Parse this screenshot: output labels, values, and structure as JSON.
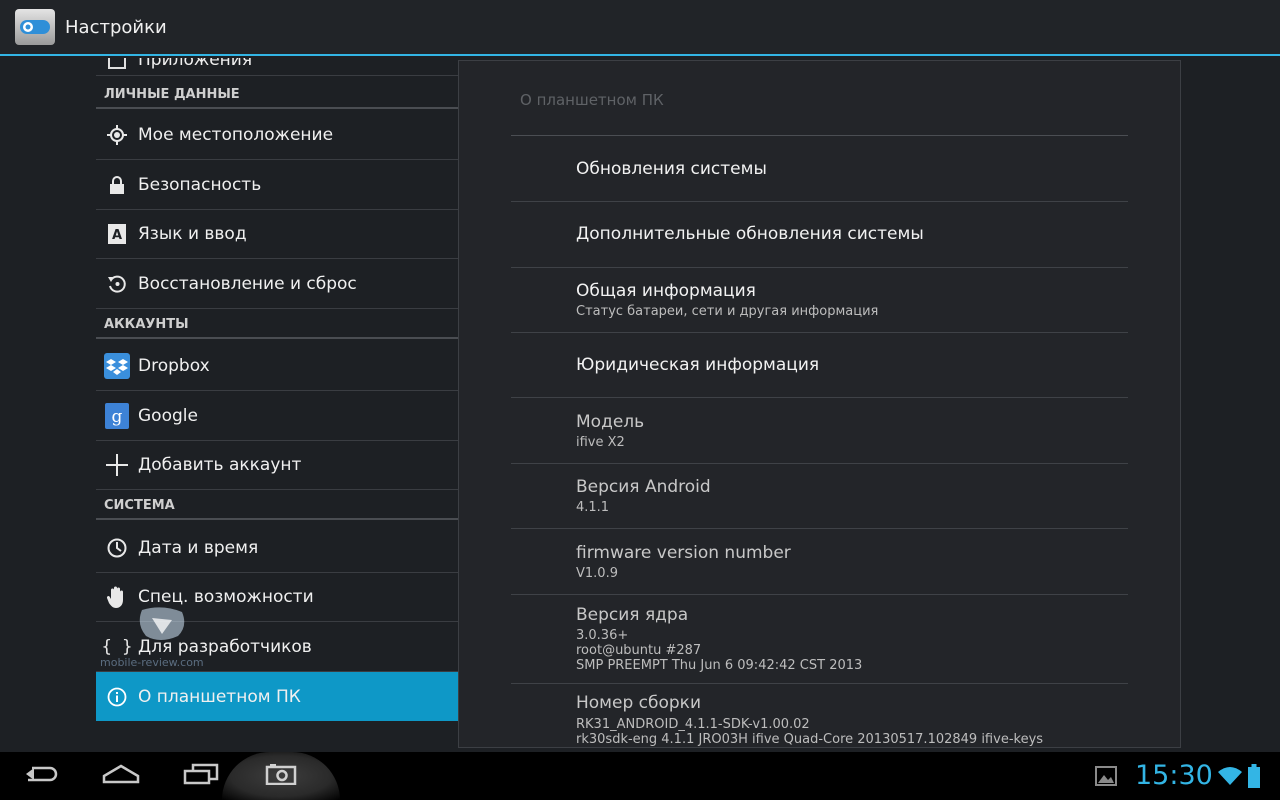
{
  "app": {
    "title": "Настройки",
    "icon": "settings-toggle-icon"
  },
  "sidebar": {
    "partial_item": "Приложения",
    "sections": [
      {
        "label": "ЛИЧНЫЕ ДАННЫЕ"
      },
      {
        "label": "АККАУНТЫ"
      },
      {
        "label": "СИСТЕМА"
      }
    ],
    "items": [
      {
        "label": "Мое местоположение",
        "icon": "location-icon"
      },
      {
        "label": "Безопасность",
        "icon": "lock-icon"
      },
      {
        "label": "Язык и ввод",
        "icon": "language-icon"
      },
      {
        "label": "Восстановление и сброс",
        "icon": "restore-icon"
      },
      {
        "label": "Dropbox",
        "icon": "dropbox-icon"
      },
      {
        "label": "Google",
        "icon": "google-icon"
      },
      {
        "label": "Добавить аккаунт",
        "icon": "plus-icon"
      },
      {
        "label": "Дата и время",
        "icon": "clock-icon"
      },
      {
        "label": "Спец. возможности",
        "icon": "hand-icon"
      },
      {
        "label": "Для разработчиков",
        "icon": "braces-icon"
      },
      {
        "label": "О планшетном ПК",
        "icon": "info-icon",
        "selected": true
      }
    ]
  },
  "details": {
    "title": "О планшетном ПК",
    "prefs": [
      {
        "title": "Обновления системы"
      },
      {
        "title": "Дополнительные обновления системы"
      },
      {
        "title": "Общая информация",
        "summary": "Статус батареи, сети и другая информация"
      },
      {
        "title": "Юридическая информация"
      },
      {
        "title": "Модель",
        "summary": "ifive X2"
      },
      {
        "title": "Версия Android",
        "summary": "4.1.1"
      },
      {
        "title": "firmware version number",
        "summary": "V1.0.9"
      },
      {
        "title": "Версия ядра",
        "summary_lines": [
          "3.0.36+",
          "root@ubuntu #287",
          "SMP PREEMPT Thu Jun 6 09:42:42 CST 2013"
        ]
      },
      {
        "title": "Номер сборки",
        "summary_lines": [
          "RK31_ANDROID_4.1.1-SDK-v1.00.02",
          "rk30sdk-eng 4.1.1 JRO03H ifive Quad-Core 20130517.102849 ifive-keys"
        ]
      }
    ]
  },
  "statusbar": {
    "time": "15:30",
    "accent": "#33b5e5",
    "selected_color": "#0e98c7"
  },
  "watermark": "mobile-review.com"
}
